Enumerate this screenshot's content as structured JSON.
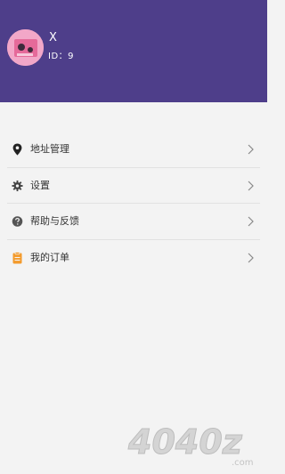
{
  "profile": {
    "name": "X",
    "id_text": "ID：9"
  },
  "menu": {
    "items": [
      {
        "label": "地址管理",
        "icon": "location-pin-icon"
      },
      {
        "label": "设置",
        "icon": "gear-icon"
      },
      {
        "label": "帮助与反馈",
        "icon": "help-icon"
      },
      {
        "label": "我的订单",
        "icon": "order-clipboard-icon"
      }
    ]
  },
  "watermark": {
    "text": "4040z",
    "sub": ".com"
  },
  "colors": {
    "header_bg": "#4e3e8a",
    "order_icon": "#f39a2b",
    "icon_dark": "#333333",
    "help_icon": "#5a5a5a"
  }
}
